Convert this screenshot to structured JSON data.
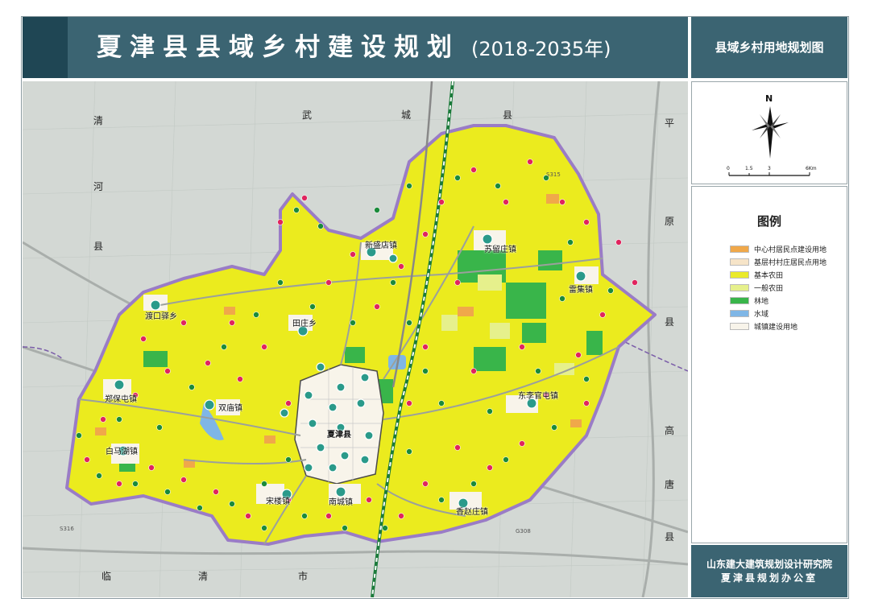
{
  "title": {
    "main": "夏津县县域乡村建设规划",
    "years": "(2018-2035年)"
  },
  "subtitle": "县域乡村用地规划图",
  "north": {
    "label": "N",
    "scale_ticks": [
      "0",
      "1.5",
      "3",
      "6Km"
    ]
  },
  "legend": {
    "title": "图例",
    "items": [
      {
        "label": "中心村居民点建设用地",
        "color": "#f0a84a"
      },
      {
        "label": "基层村村庄居民点用地",
        "color": "#f6e4c8"
      },
      {
        "label": "基本农田",
        "color": "#eaea2a"
      },
      {
        "label": "一般农田",
        "color": "#e6f08c"
      },
      {
        "label": "林地",
        "color": "#39b54a"
      },
      {
        "label": "水域",
        "color": "#7fb6e6"
      },
      {
        "label": "城镇建设用地",
        "color": "#f8f4ea"
      }
    ]
  },
  "organization": [
    "山东建大建筑规划设计研究院",
    "夏津县规划办公室"
  ],
  "map": {
    "surrounding_labels": [
      "清",
      "河",
      "县",
      "武",
      "城",
      "县",
      "平",
      "原",
      "县",
      "高",
      "唐",
      "县",
      "临",
      "清",
      "市"
    ],
    "towns": [
      "新盛店镇",
      "苏留庄镇",
      "雷集镇",
      "渡口驿乡",
      "田庄乡",
      "郑保屯镇",
      "双庙镇",
      "东李官屯镇",
      "夏津县",
      "白马湖镇",
      "宋楼镇",
      "南城镇",
      "香赵庄镇"
    ],
    "road_labels": [
      "S315",
      "S316",
      "G308"
    ]
  }
}
